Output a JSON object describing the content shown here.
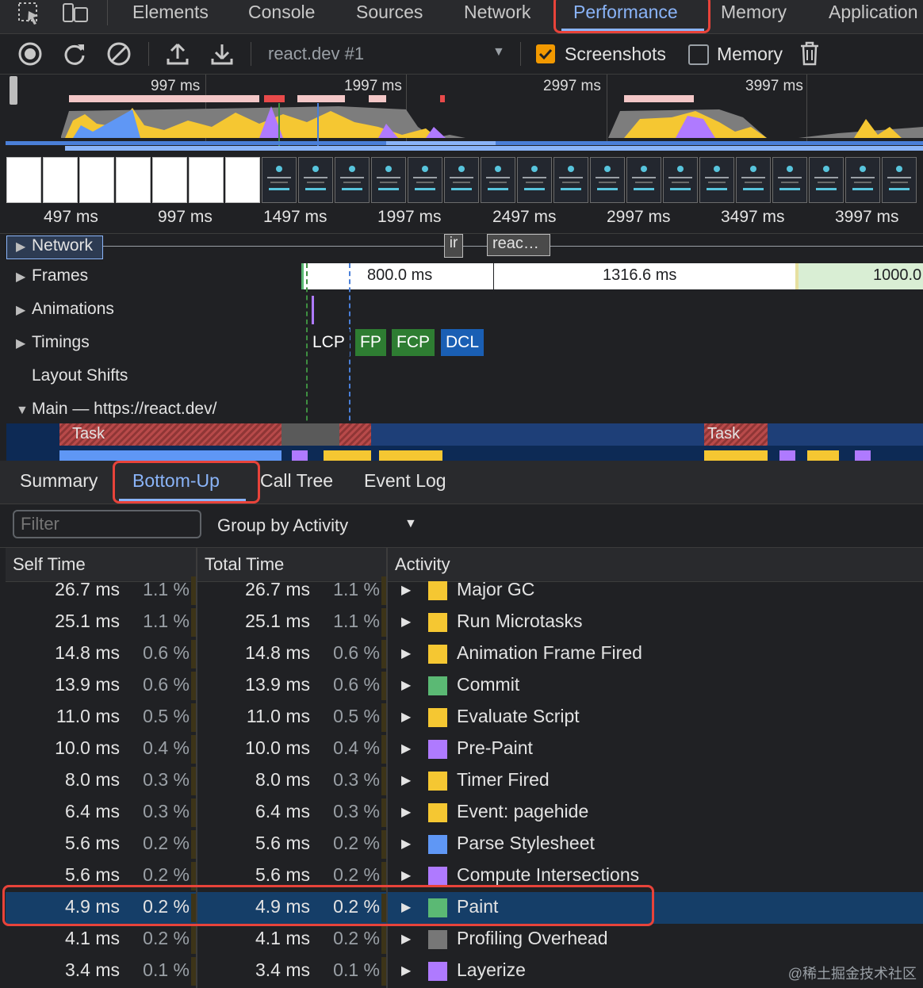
{
  "tabs": [
    "Elements",
    "Console",
    "Sources",
    "Network",
    "Performance",
    "Memory",
    "Application"
  ],
  "active_tab": "Performance",
  "toolbar": {
    "recording_select": "react.dev #1",
    "screenshots_label": "Screenshots",
    "screenshots_checked": true,
    "memory_label": "Memory",
    "memory_checked": false
  },
  "overview": {
    "ticks": [
      "997 ms",
      "1997 ms",
      "2997 ms",
      "3997 ms"
    ]
  },
  "ruler": {
    "ticks": [
      "497 ms",
      "997 ms",
      "1497 ms",
      "1997 ms",
      "2497 ms",
      "2997 ms",
      "3497 ms",
      "3997 ms"
    ]
  },
  "tracks": {
    "network": "Network",
    "network_req1": "ir",
    "network_req2": "reac…",
    "frames": "Frames",
    "frame1": "800.0 ms",
    "frame2": "1316.6 ms",
    "frame3": "1000.0",
    "animations": "Animations",
    "timings": "Timings",
    "timing_lcp": "LCP",
    "timing_fp": "FP",
    "timing_fcp": "FCP",
    "timing_dcl": "DCL",
    "layout_shifts": "Layout Shifts",
    "main": "Main — https://react.dev/",
    "task1": "Task",
    "task2": "Task"
  },
  "bottom_tabs": [
    "Summary",
    "Bottom-Up",
    "Call Tree",
    "Event Log"
  ],
  "active_bottom_tab": "Bottom-Up",
  "filter": {
    "placeholder": "Filter",
    "group_by": "Group by Activity"
  },
  "table": {
    "headers": [
      "Self Time",
      "Total Time",
      "Activity"
    ],
    "rows": [
      {
        "self": "26.7 ms",
        "self_pct": "1.1 %",
        "total": "26.7 ms",
        "total_pct": "1.1 %",
        "activity": "Major GC",
        "color": "#f5c732"
      },
      {
        "self": "25.1 ms",
        "self_pct": "1.1 %",
        "total": "25.1 ms",
        "total_pct": "1.1 %",
        "activity": "Run Microtasks",
        "color": "#f5c732"
      },
      {
        "self": "14.8 ms",
        "self_pct": "0.6 %",
        "total": "14.8 ms",
        "total_pct": "0.6 %",
        "activity": "Animation Frame Fired",
        "color": "#f5c732"
      },
      {
        "self": "13.9 ms",
        "self_pct": "0.6 %",
        "total": "13.9 ms",
        "total_pct": "0.6 %",
        "activity": "Commit",
        "color": "#5bb974"
      },
      {
        "self": "11.0 ms",
        "self_pct": "0.5 %",
        "total": "11.0 ms",
        "total_pct": "0.5 %",
        "activity": "Evaluate Script",
        "color": "#f5c732"
      },
      {
        "self": "10.0 ms",
        "self_pct": "0.4 %",
        "total": "10.0 ms",
        "total_pct": "0.4 %",
        "activity": "Pre-Paint",
        "color": "#af7aff"
      },
      {
        "self": "8.0 ms",
        "self_pct": "0.3 %",
        "total": "8.0 ms",
        "total_pct": "0.3 %",
        "activity": "Timer Fired",
        "color": "#f5c732"
      },
      {
        "self": "6.4 ms",
        "self_pct": "0.3 %",
        "total": "6.4 ms",
        "total_pct": "0.3 %",
        "activity": "Event: pagehide",
        "color": "#f5c732"
      },
      {
        "self": "5.6 ms",
        "self_pct": "0.2 %",
        "total": "5.6 ms",
        "total_pct": "0.2 %",
        "activity": "Parse Stylesheet",
        "color": "#5f97f5"
      },
      {
        "self": "5.6 ms",
        "self_pct": "0.2 %",
        "total": "5.6 ms",
        "total_pct": "0.2 %",
        "activity": "Compute Intersections",
        "color": "#af7aff"
      },
      {
        "self": "4.9 ms",
        "self_pct": "0.2 %",
        "total": "4.9 ms",
        "total_pct": "0.2 %",
        "activity": "Paint",
        "color": "#5bb974"
      },
      {
        "self": "4.1 ms",
        "self_pct": "0.2 %",
        "total": "4.1 ms",
        "total_pct": "0.2 %",
        "activity": "Profiling Overhead",
        "color": "#777777"
      },
      {
        "self": "3.4 ms",
        "self_pct": "0.1 %",
        "total": "3.4 ms",
        "total_pct": "0.1 %",
        "activity": "Layerize",
        "color": "#af7aff"
      }
    ],
    "selected_activity": "Paint"
  },
  "watermark": "@稀土掘金技术社区"
}
